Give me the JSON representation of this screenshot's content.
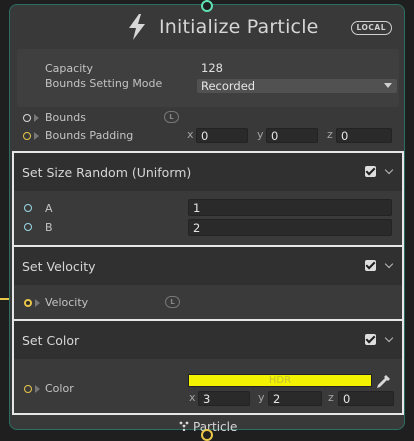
{
  "node": {
    "title": "Initialize Particle",
    "badge": "LOCAL",
    "footer_label": "Particle"
  },
  "settings": {
    "capacity_label": "Capacity",
    "capacity_value": "128",
    "bounds_mode_label": "Bounds Setting Mode",
    "bounds_mode_value": "Recorded"
  },
  "inputs": {
    "bounds_label": "Bounds",
    "bounds_padding_label": "Bounds Padding",
    "padding": {
      "x_label": "x",
      "x": "0",
      "y_label": "y",
      "y": "0",
      "z_label": "z",
      "z": "0"
    },
    "l_tag": "L"
  },
  "blocks": [
    {
      "title": "Set Size Random (Uniform)",
      "params": [
        {
          "label": "A",
          "value": "1"
        },
        {
          "label": "B",
          "value": "2"
        }
      ]
    },
    {
      "title": "Set Velocity",
      "param_label": "Velocity",
      "l_tag": "L"
    },
    {
      "title": "Set Color",
      "param_label": "Color",
      "hdr_label": "HDR",
      "color_hex": "#f3f200",
      "rgb": {
        "x_label": "x",
        "x": "3",
        "y_label": "y",
        "y": "2",
        "z_label": "z",
        "z": "0"
      }
    }
  ]
}
